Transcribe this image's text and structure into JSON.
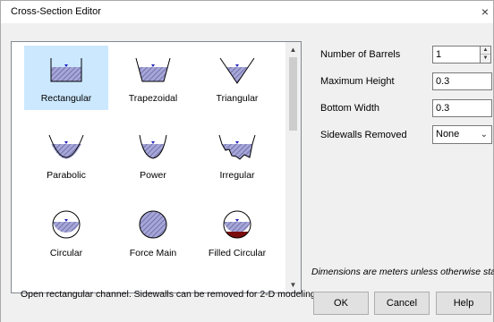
{
  "window": {
    "title": "Cross-Section Editor",
    "close_glyph": "×"
  },
  "shapes": [
    {
      "name": "rectangular",
      "label": "Rectangular",
      "selected": true
    },
    {
      "name": "trapezoidal",
      "label": "Trapezoidal",
      "selected": false
    },
    {
      "name": "triangular",
      "label": "Triangular",
      "selected": false
    },
    {
      "name": "parabolic",
      "label": "Parabolic",
      "selected": false
    },
    {
      "name": "power",
      "label": "Power",
      "selected": false
    },
    {
      "name": "irregular",
      "label": "Irregular",
      "selected": false
    },
    {
      "name": "circular",
      "label": "Circular",
      "selected": false
    },
    {
      "name": "force-main",
      "label": "Force Main",
      "selected": false
    },
    {
      "name": "filled-circular",
      "label": "Filled Circular",
      "selected": false
    }
  ],
  "fields": {
    "barrels": {
      "label": "Number of Barrels",
      "value": "1"
    },
    "max_height": {
      "label": "Maximum Height",
      "value": "0.3"
    },
    "bottom_width": {
      "label": "Bottom Width",
      "value": "0.3"
    },
    "sidewalls": {
      "label": "Sidewalls Removed",
      "value": "None"
    }
  },
  "note": "Dimensions are meters unless otherwise stated.",
  "description": "Open rectangular channel. Sidewalls can be removed for 2-D modeling.",
  "buttons": {
    "ok": "OK",
    "cancel": "Cancel",
    "help": "Help"
  },
  "colors": {
    "selection": "#cce8ff",
    "fill": "#a6a6d8",
    "hatch": "#5e5e99",
    "sediment": "#7a0e0e",
    "water_mark": "#1e1ebe"
  },
  "icons": {
    "scroll_up": "▲",
    "scroll_down": "▼",
    "spin_up": "▲",
    "spin_down": "▼",
    "dropdown": "⌄"
  }
}
